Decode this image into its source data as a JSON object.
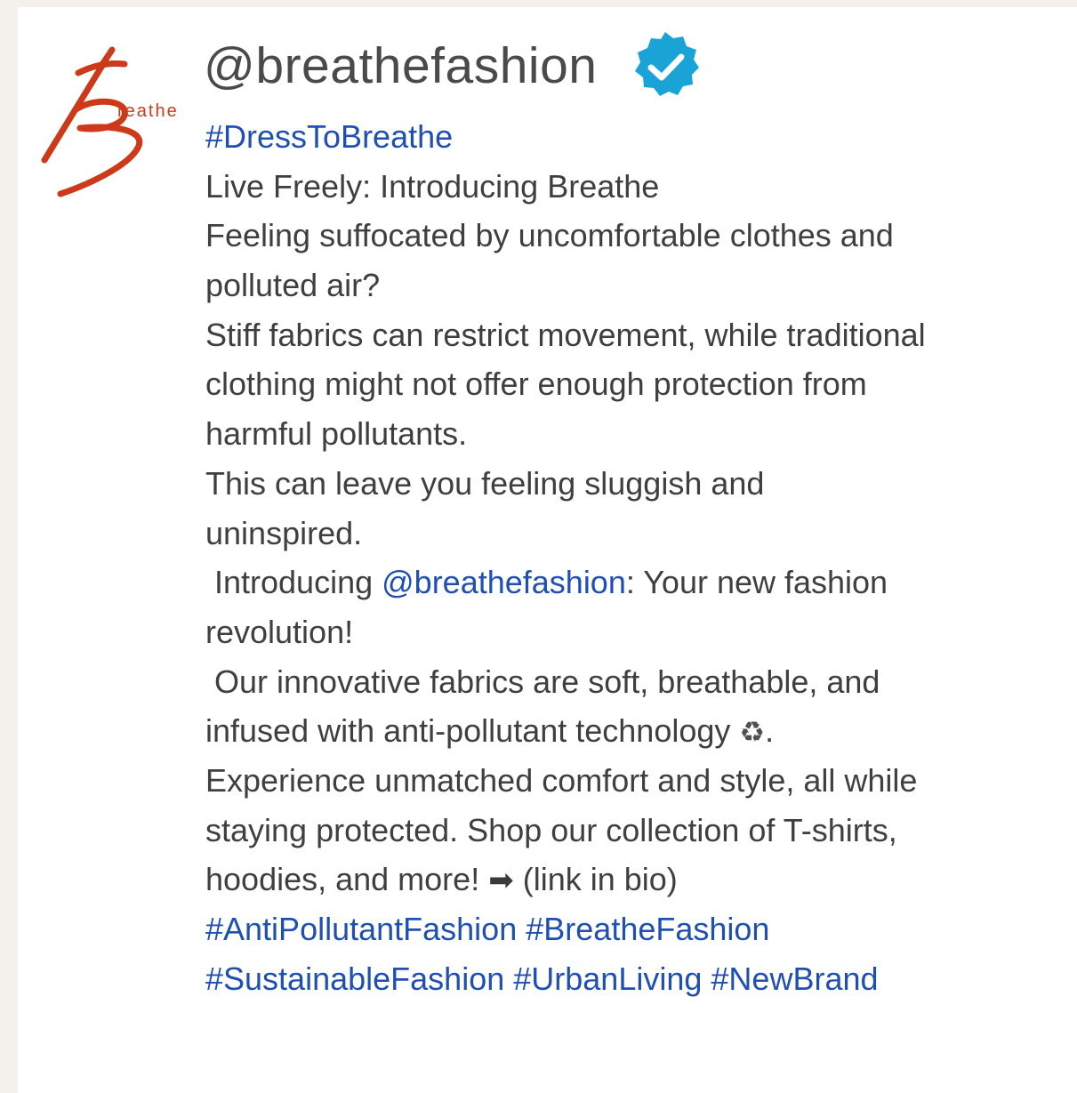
{
  "profile": {
    "logo_text": "reathe",
    "handle": "@breathefashion",
    "verified_icon": "verified-check-icon",
    "brand_color": "#cc3a1a",
    "badge_color": "#1aa3d6"
  },
  "post": {
    "hashtag_top": "#DressToBreathe",
    "line_1": "Live Freely: Introducing Breathe",
    "line_2": "Feeling suffocated by uncomfortable clothes and",
    "line_3": "polluted air?",
    "line_4": "Stiff fabrics can restrict movement, while traditional",
    "line_5": "clothing might not offer enough protection from",
    "line_6": "harmful pollutants.",
    "line_7": "This can leave you feeling sluggish and",
    "line_8": "uninspired.",
    "line_9_pre": "Introducing ",
    "line_9_mention": "@breathefashion",
    "line_9_post": ": Your new fashion",
    "line_10": "revolution!",
    "line_11": "Our innovative fabrics are soft, breathable, and",
    "line_12_pre": "infused with anti-pollutant technology ",
    "recycle_glyph": "♻",
    "line_12_post": ".",
    "line_13": "Experience unmatched comfort and style, all while",
    "line_14": "staying protected. Shop our collection of T-shirts,",
    "line_15_pre": "hoodies, and more! ",
    "arrow_glyph": "➡",
    "line_15_post": " (link in bio)",
    "hashtags_row_1": [
      "#AntiPollutantFashion",
      "#BreatheFashion"
    ],
    "hashtags_row_2": [
      "#SustainableFashion",
      "#UrbanLiving",
      "#NewBrand"
    ],
    "link_color": "#1f4fb3"
  }
}
